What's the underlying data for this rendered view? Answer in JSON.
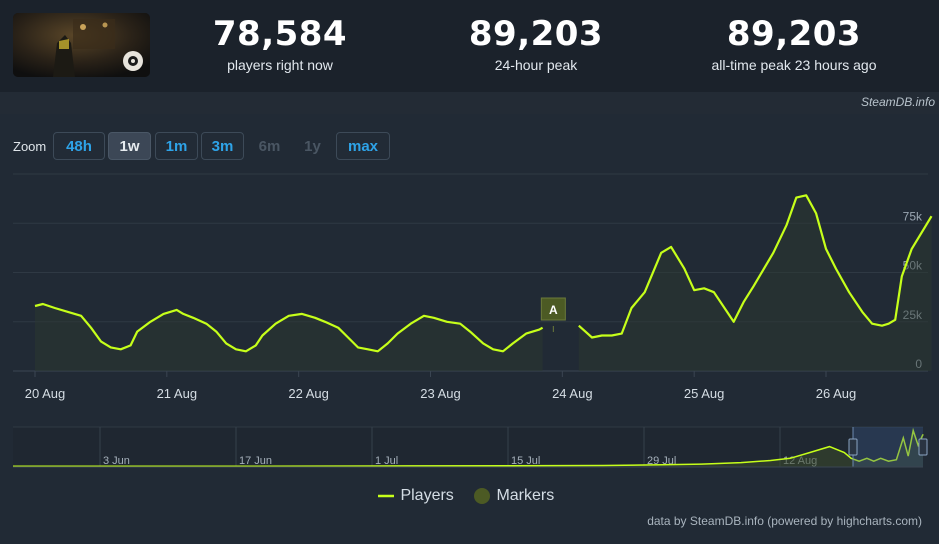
{
  "stats": [
    {
      "value": "78,584",
      "label": "players right now"
    },
    {
      "value": "89,203",
      "label": "24-hour peak"
    },
    {
      "value": "89,203",
      "label": "all-time peak 23 hours ago"
    }
  ],
  "credit_top": "SteamDB.info",
  "zoom": {
    "label": "Zoom",
    "buttons": [
      {
        "label": "48h",
        "state": "enabled"
      },
      {
        "label": "1w",
        "state": "active"
      },
      {
        "label": "1m",
        "state": "enabled"
      },
      {
        "label": "3m",
        "state": "enabled"
      },
      {
        "label": "6m",
        "state": "disabled"
      },
      {
        "label": "1y",
        "state": "disabled"
      },
      {
        "label": "max",
        "state": "enabled"
      }
    ]
  },
  "legend": {
    "players": "Players",
    "markers": "Markers"
  },
  "credit_bottom": "data by SteamDB.info (powered by highcharts.com)",
  "colors": {
    "line": "#c6ff1a",
    "marker": "#4c5a24",
    "button_text": "#2ea3e8"
  },
  "chart_data": {
    "type": "line",
    "series": [
      {
        "name": "Players",
        "points": [
          [
            0,
            33
          ],
          [
            0.12,
            34
          ],
          [
            0.3,
            32
          ],
          [
            0.5,
            30
          ],
          [
            0.7,
            28
          ],
          [
            0.85,
            22
          ],
          [
            1.0,
            15
          ],
          [
            1.15,
            12
          ],
          [
            1.3,
            11
          ],
          [
            1.45,
            13
          ],
          [
            1.55,
            20
          ],
          [
            1.75,
            25
          ],
          [
            1.95,
            29
          ],
          [
            2.15,
            31
          ],
          [
            2.25,
            29
          ],
          [
            2.4,
            27
          ],
          [
            2.6,
            24
          ],
          [
            2.75,
            20
          ],
          [
            2.9,
            14
          ],
          [
            3.05,
            11
          ],
          [
            3.2,
            10
          ],
          [
            3.35,
            13
          ],
          [
            3.45,
            18
          ],
          [
            3.65,
            24
          ],
          [
            3.85,
            28
          ],
          [
            4.05,
            29
          ],
          [
            4.25,
            27
          ],
          [
            4.4,
            25
          ],
          [
            4.6,
            22
          ],
          [
            4.75,
            17
          ],
          [
            4.9,
            12
          ],
          [
            5.05,
            11
          ],
          [
            5.2,
            10
          ],
          [
            5.35,
            14
          ],
          [
            5.5,
            19
          ],
          [
            5.7,
            24
          ],
          [
            5.9,
            28
          ],
          [
            6.05,
            27
          ],
          [
            6.25,
            25
          ],
          [
            6.45,
            24
          ],
          [
            6.6,
            20
          ],
          [
            6.8,
            14
          ],
          [
            6.95,
            11
          ],
          [
            7.1,
            10
          ],
          [
            7.25,
            14
          ],
          [
            7.45,
            19
          ],
          [
            7.65,
            21
          ],
          [
            7.7,
            22
          ]
        ]
      },
      {
        "name": "Players",
        "points": [
          [
            8.25,
            23
          ],
          [
            8.35,
            20
          ],
          [
            8.45,
            17
          ],
          [
            8.6,
            18
          ],
          [
            8.75,
            18
          ],
          [
            8.9,
            19
          ],
          [
            9.05,
            32
          ],
          [
            9.25,
            40
          ],
          [
            9.5,
            60
          ],
          [
            9.65,
            63
          ],
          [
            9.85,
            52
          ],
          [
            10.0,
            41
          ],
          [
            10.15,
            42
          ],
          [
            10.3,
            40
          ],
          [
            10.5,
            30
          ],
          [
            10.6,
            25
          ],
          [
            10.75,
            35
          ],
          [
            10.9,
            43
          ],
          [
            11.2,
            60
          ],
          [
            11.4,
            74
          ],
          [
            11.55,
            88
          ],
          [
            11.7,
            89.2
          ],
          [
            11.85,
            80
          ],
          [
            12.0,
            62
          ],
          [
            12.15,
            52
          ],
          [
            12.35,
            40
          ],
          [
            12.55,
            30
          ],
          [
            12.7,
            24
          ],
          [
            12.85,
            23
          ],
          [
            12.95,
            24
          ],
          [
            13.05,
            26
          ],
          [
            13.15,
            48
          ],
          [
            13.3,
            62
          ],
          [
            13.5,
            73
          ],
          [
            13.6,
            78.6
          ]
        ]
      }
    ],
    "markers": [
      {
        "label": "A",
        "x": 8.0
      }
    ],
    "x_axis": {
      "ticks": [
        {
          "x": 0,
          "label": "20 Aug"
        },
        {
          "x": 2,
          "label": "21 Aug"
        },
        {
          "x": 4,
          "label": "22 Aug"
        },
        {
          "x": 6,
          "label": "23 Aug"
        },
        {
          "x": 8,
          "label": "24 Aug"
        },
        {
          "x": 10,
          "label": "25 Aug"
        },
        {
          "x": 12,
          "label": "26 Aug"
        }
      ],
      "range": [
        -0.2,
        13.6
      ]
    },
    "y_axis": {
      "ticks": [
        {
          "v": 0,
          "label": "0"
        },
        {
          "v": 25,
          "label": "25k"
        },
        {
          "v": 50,
          "label": "50k"
        },
        {
          "v": 75,
          "label": "75k"
        }
      ],
      "range": [
        0,
        100
      ]
    },
    "navigator": {
      "labels": [
        "3 Jun",
        "17 Jun",
        "1 Jul",
        "15 Jul",
        "29 Jul",
        "12 Aug"
      ],
      "points": [
        [
          0,
          1
        ],
        [
          60,
          1
        ],
        [
          200,
          1
        ],
        [
          400,
          1.5
        ],
        [
          600,
          2
        ],
        [
          660,
          3
        ],
        [
          700,
          4
        ],
        [
          740,
          6
        ],
        [
          770,
          9
        ],
        [
          790,
          12
        ],
        [
          810,
          20
        ],
        [
          830,
          28
        ],
        [
          845,
          20
        ],
        [
          852,
          12
        ],
        [
          860,
          8
        ],
        [
          868,
          12
        ],
        [
          875,
          8
        ],
        [
          882,
          12
        ],
        [
          890,
          8
        ],
        [
          898,
          10
        ],
        [
          905,
          40
        ],
        [
          910,
          15
        ],
        [
          915,
          50
        ],
        [
          920,
          30
        ],
        [
          925,
          45
        ]
      ]
    }
  }
}
